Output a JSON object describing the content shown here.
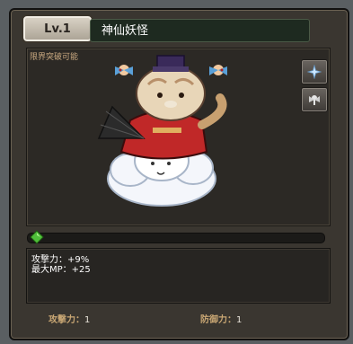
{
  "header": {
    "level": "Lv.1",
    "name": "神仙妖怪"
  },
  "stage": {
    "status": "限界突破可能",
    "buttons": [
      {
        "icon": "sparkle-icon"
      },
      {
        "icon": "fairy-icon"
      }
    ]
  },
  "progress": {
    "fraction": 0.0
  },
  "effects": [
    "攻撃力：+9%",
    "最大MP：+25"
  ],
  "footer": {
    "attack_label": "攻撃力：",
    "attack_value": "1",
    "defense_label": "防御力：",
    "defense_value": "1"
  }
}
